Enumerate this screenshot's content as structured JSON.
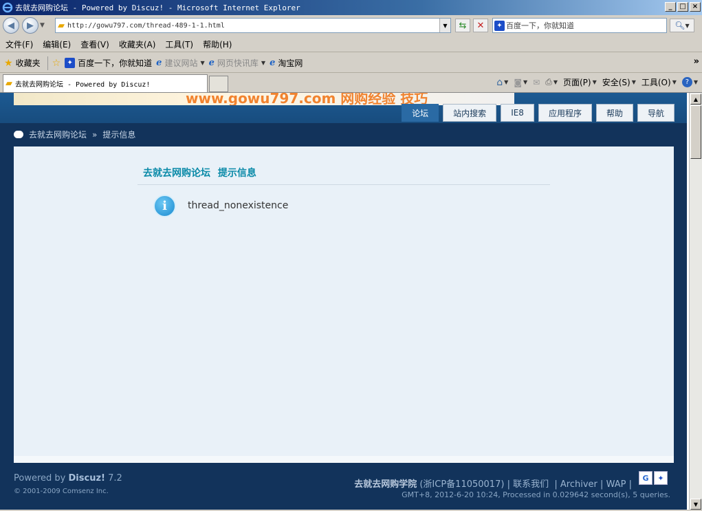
{
  "window": {
    "title": "去就去网购论坛 - Powered by Discuz! - Microsoft Internet Explorer",
    "minimize": "_",
    "maximize": "□",
    "close": "×"
  },
  "address": {
    "url": "http://gowu797.com/thread-489-1-1.html",
    "search_placeholder": "百度一下，你就知道"
  },
  "menu": [
    "文件(F)",
    "编辑(E)",
    "查看(V)",
    "收藏夹(A)",
    "工具(T)",
    "帮助(H)"
  ],
  "favorites": {
    "label": "收藏夹",
    "items": [
      "百度一下，你就知道",
      "建议网站",
      "网页快讯库",
      "淘宝网"
    ]
  },
  "tab": {
    "title": "去就去网购论坛 - Powered by Discuz!"
  },
  "commands": {
    "page": "页面(P)",
    "safety": "安全(S)",
    "tools": "工具(O)"
  },
  "site": {
    "banner_text": "www.gowu797.com 网购经验 技巧",
    "nav": [
      "论坛",
      "站内搜索",
      "IE8",
      "应用程序",
      "帮助",
      "导航"
    ],
    "nav_active": 0,
    "breadcrumb_home": "去就去网购论坛",
    "breadcrumb_sep": "»",
    "breadcrumb_current": "提示信息"
  },
  "message": {
    "forum_name": "去就去网购论坛",
    "title": "提示信息",
    "text": "thread_nonexistence"
  },
  "footer": {
    "powered_prefix": "Powered by",
    "powered_brand": "Discuz!",
    "powered_version": "7.2",
    "copyright": "© 2001-2009 Comsenz Inc.",
    "site_name": "去就去网购学院",
    "icp": "(浙ICP备11050017)",
    "contact": "联系我们",
    "archiver": "Archiver",
    "wap": "WAP",
    "stats": "GMT+8, 2012-6-20 10:24, Processed in 0.029642 second(s), 5 queries."
  },
  "colors": {
    "page_bg": "#12335b",
    "title_accent": "#0a8aa8",
    "nav_active": "#2a6aa4"
  }
}
